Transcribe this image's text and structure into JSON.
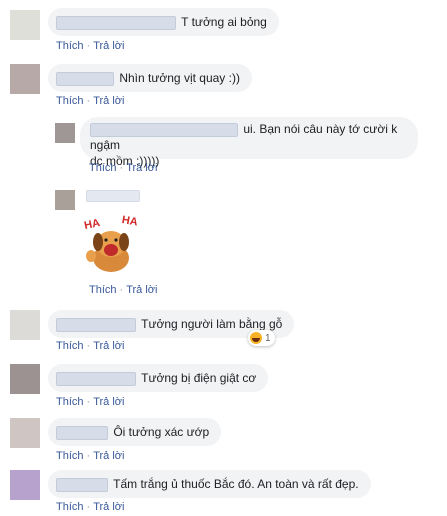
{
  "colors": {
    "bubble": "#f2f3f5",
    "link": "#385898",
    "avatars": [
      "#dedfd9",
      "#b6a9a7",
      "#9e9796",
      "#a9a09a",
      "#9c9291",
      "#cfc5c3",
      "#b7a2cd"
    ]
  },
  "actions": {
    "like": "Thích",
    "reply": "Trả lời",
    "separator": "·"
  },
  "comments": [
    {
      "text": "T tưởng ai bỏng"
    },
    {
      "text": "Nhìn tưởng vịt quay :))"
    },
    {
      "text_line1": "ui. Bạn nói câu này tớ cười k ngậm",
      "text_line2": "dc mồm :)))))"
    },
    {
      "sticker": "haha-dog-sticker",
      "sticker_text": [
        "HA",
        "HA"
      ]
    },
    {
      "text": "Tưởng người làm bằng gỗ",
      "reaction_icon": "haha-emoji-icon",
      "reaction_count": "1"
    },
    {
      "text": "Tưởng bị điện giật cơ"
    },
    {
      "text": "Ôi tưởng xác ướp"
    },
    {
      "text": "Tấm trắng ủ thuốc Bắc đó. An toàn và rất đẹp."
    }
  ]
}
